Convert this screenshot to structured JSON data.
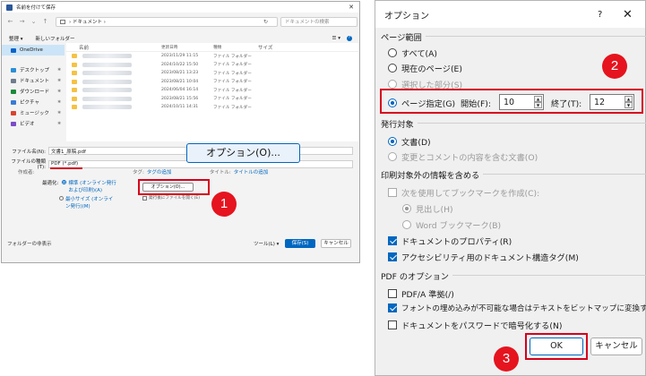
{
  "save_dialog": {
    "title": "名前を付けて保存",
    "close_label": "✕",
    "address": {
      "path": "› ドキュメント ›",
      "search_placeholder": "ドキュメントの検索"
    },
    "toolbar": {
      "organize": "整理 ▾",
      "new_folder": "新しいフォルダー",
      "view": "☰ ▾",
      "help": "?"
    },
    "nav_items": [
      {
        "label": "OneDrive",
        "color": "#0a64c8",
        "selected": true
      },
      {
        "label": "デスクトップ",
        "color": "#2a8fd6",
        "selected": false
      },
      {
        "label": "ドキュメント",
        "color": "#6d7d8d",
        "selected": false
      },
      {
        "label": "ダウンロード",
        "color": "#1b8a3a",
        "selected": false
      },
      {
        "label": "ピクチャ",
        "color": "#3a7bd5",
        "selected": false
      },
      {
        "label": "ミュージック",
        "color": "#d9432f",
        "selected": false
      },
      {
        "label": "ビデオ",
        "color": "#7b4bc8",
        "selected": false
      }
    ],
    "columns": [
      "名前",
      "更新日時",
      "種類",
      "サイズ"
    ],
    "rows": [
      {
        "date": "2023/11/29 11:15",
        "type": "ファイル フォルダー"
      },
      {
        "date": "2024/10/22 15:50",
        "type": "ファイル フォルダー"
      },
      {
        "date": "2023/08/21 13:23",
        "type": "ファイル フォルダー"
      },
      {
        "date": "2023/08/21 10:04",
        "type": "ファイル フォルダー"
      },
      {
        "date": "2024/06/04 16:14",
        "type": "ファイル フォルダー"
      },
      {
        "date": "2023/08/21 15:56",
        "type": "ファイル フォルダー"
      },
      {
        "date": "2024/10/11 14:31",
        "type": "ファイル フォルダー"
      }
    ],
    "filename_label": "ファイル名(N):",
    "filename_value": "文書1_原稿.pdf",
    "filetype_label": "ファイルの種類(T):",
    "filetype_value": "PDF (*.pdf)",
    "meta": {
      "author_label": "作成者:",
      "tag_label": "タグ:",
      "tag_value": "タグの追加",
      "title_label": "タイトル:",
      "title_value": "タイトルの追加"
    },
    "optimize_label": "最適化:",
    "optimize_standard": "標準 (オンライン発行および印刷)(A)",
    "optimize_minimum": "最小サイズ (オンライン発行)(M)",
    "options_button": "オプション(O)...",
    "open_after_label": "発行後にファイルを開く(E)",
    "hide_folders": "フォルダーの非表示",
    "tools": "ツール(L) ▾",
    "save_button": "保存(S)",
    "cancel_button": "キャンセル"
  },
  "callout": {
    "options_button": "オプション(O)..."
  },
  "badges": [
    "1",
    "2",
    "3"
  ],
  "options": {
    "title": "オプション",
    "help": "?",
    "close": "✕",
    "page_range": {
      "heading": "ページ範囲",
      "all": "すべて(A)",
      "current": "現在のページ(E)",
      "selection": "選択した部分(S)",
      "pages": "ページ指定(G)",
      "from_label": "開始(F):",
      "from_value": "10",
      "to_label": "終了(T):",
      "to_value": "12"
    },
    "publish": {
      "heading": "発行対象",
      "document": "文書(D)",
      "markup": "変更とコメントの内容を含む文書(O)"
    },
    "include": {
      "heading": "印刷対象外の情報を含める",
      "bookmarks": "次を使用してブックマークを作成(C):",
      "headings": "見出し(H)",
      "word_bookmarks": "Word ブックマーク(B)",
      "properties": "ドキュメントのプロパティ(R)",
      "accessibility": "アクセシビリティ用のドキュメント構造タグ(M)"
    },
    "pdf": {
      "heading": "PDF のオプション",
      "pdfa": "PDF/A 準拠(/)",
      "bitmap": "フォントの埋め込みが不可能な場合はテキストをビットマップに変換する(X)",
      "encrypt": "ドキュメントをパスワードで暗号化する(N)"
    },
    "ok": "OK",
    "cancel": "キャンセル"
  }
}
